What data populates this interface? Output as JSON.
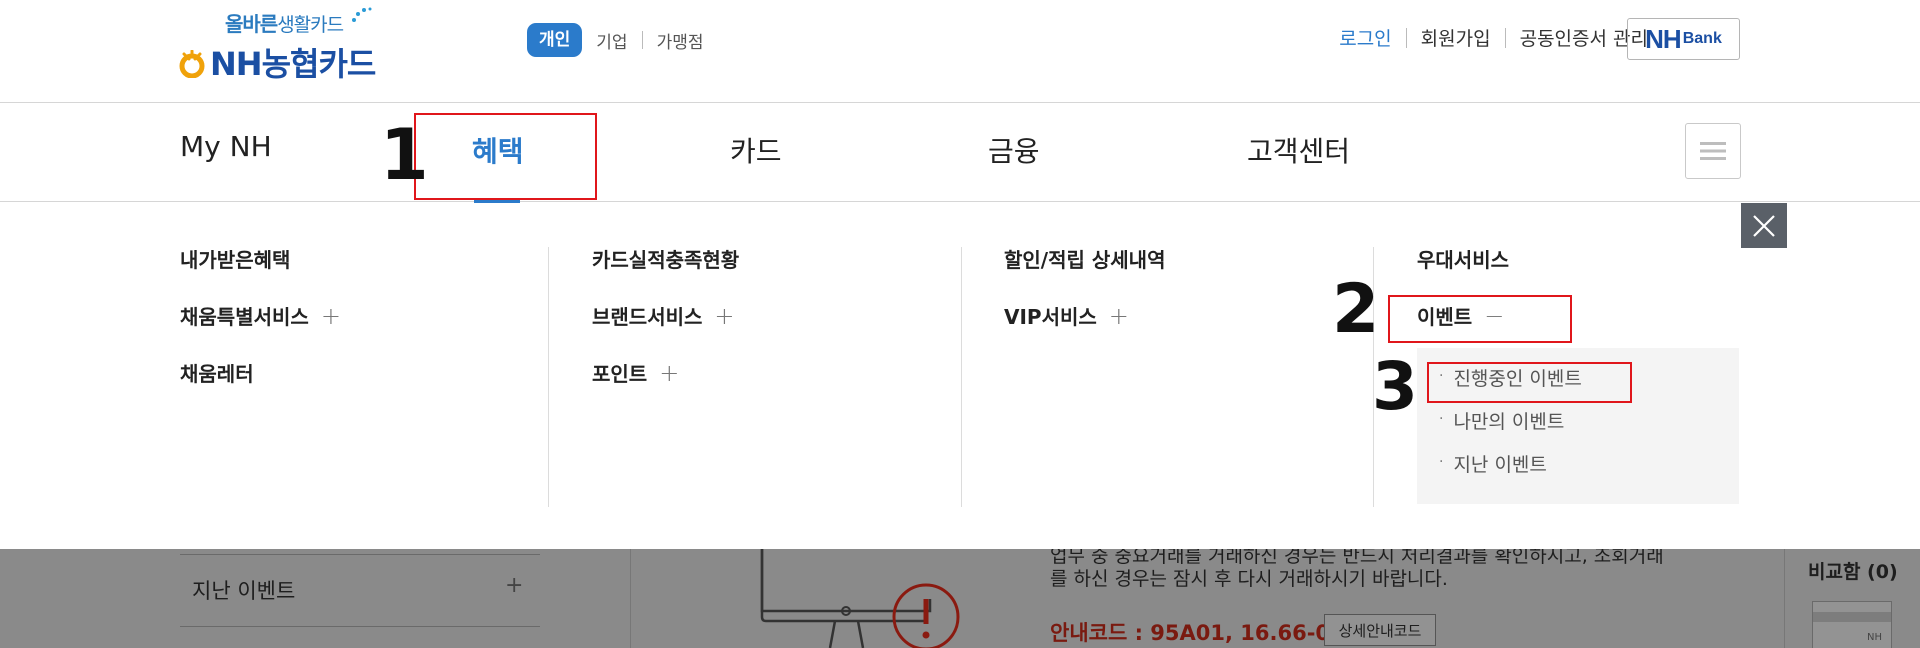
{
  "header": {
    "logo_slogan_part1": "올바른",
    "logo_slogan_part2": "생활카드",
    "logo_main": "NH농협카드",
    "user_types": {
      "personal": "개인",
      "business": "기업",
      "merchant": "가맹점"
    },
    "util": {
      "login": "로그인",
      "join": "회원가입",
      "cert": "공동인증서 관리"
    },
    "nhbank": {
      "mark": "NH",
      "label": "Bank"
    }
  },
  "gnb": {
    "items": [
      {
        "label": "My NH"
      },
      {
        "label": "혜택"
      },
      {
        "label": "카드"
      },
      {
        "label": "금융"
      },
      {
        "label": "고객센터"
      }
    ],
    "active": "혜택"
  },
  "mega": {
    "col1": [
      "내가받은혜택",
      "채움특별서비스",
      "채움레터"
    ],
    "col2": [
      "카드실적충족현황",
      "브랜드서비스",
      "포인트"
    ],
    "col3": [
      "할인/적립 상세내역",
      "VIP서비스"
    ],
    "col4": [
      "우대서비스",
      "이벤트"
    ],
    "expand_symbol": "+",
    "collapse_symbol": "−",
    "event_sub": [
      "진행중인 이벤트",
      "나만의 이벤트",
      "지난 이벤트"
    ]
  },
  "annotations": [
    "1",
    "2",
    "3"
  ],
  "background_page": {
    "sidebar_item": "지난 이벤트",
    "sidebar_plus": "+",
    "notice_line1": "업무 중 중요거래를 거래하신 경우는 반드시 처리결과를 확인하시고, 조회거래",
    "notice_line2": "를 하신 경우는 잠시 후 다시 거래하시기 바랍니다.",
    "guide_code": "안내코드 : 95A01, 16.66-01",
    "detail_button": "상세안내코드",
    "compare": "비교함 (0)",
    "nh_small": "NH"
  }
}
